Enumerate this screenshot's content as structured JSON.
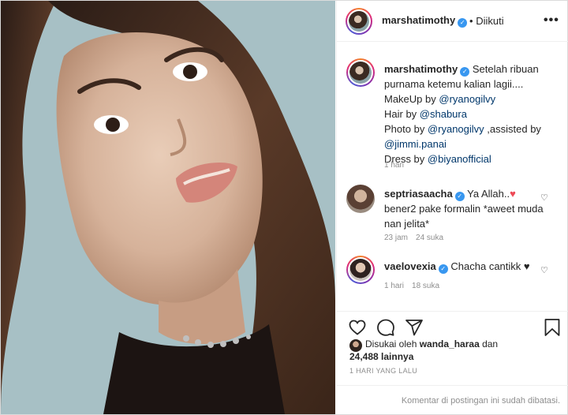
{
  "post": {
    "username": "marshatimothy",
    "separator": "•",
    "follow_status": "Diikuti",
    "more_glyph": "•••"
  },
  "caption": {
    "username": "marshatimothy",
    "line1": "Setelah ribuan purnama ketemu kalian lagii....",
    "makeup_prefix": "MakeUp by ",
    "makeup_link": "@ryanogilvy",
    "hair_prefix": "Hair by ",
    "hair_link": "@shabura",
    "photo_prefix": "Photo by ",
    "photo_link": "@ryanogilvy",
    "photo_suffix": " ,assisted by",
    "assist_link": "@jimmi.panai",
    "dress_prefix": "Dress by ",
    "dress_link": "@biyanofficial",
    "time": "1 hari"
  },
  "comments": [
    {
      "username": "septriasaacha",
      "text_before": "Ya Allah..",
      "heart_glyph": "♥",
      "text_after": "bener2 pake formalin *aweet muda nan jelita*",
      "time": "23 jam",
      "likes": "24 suka"
    },
    {
      "username": "vaelovexia",
      "text": "Chacha cantikk ♥",
      "time": "1 hari",
      "likes": "18 suka"
    }
  ],
  "likes": {
    "prefix": "Disukai oleh ",
    "user": "wanda_haraa",
    "mid": " dan",
    "count": "24,488 lainnya"
  },
  "date": "1 HARI YANG LALU",
  "comments_disabled": "Komentar di postingan ini sudah dibatasi.",
  "verified_glyph": "✓",
  "heart_outline_glyph": "♡",
  "icons": [
    "more-icon",
    "verified-icon",
    "heart-icon",
    "comment-icon",
    "share-icon",
    "bookmark-icon"
  ],
  "colors": {
    "link": "#00376b",
    "verified": "#3897f0",
    "meta": "#8e8e8e",
    "red_heart": "#ed4956"
  }
}
